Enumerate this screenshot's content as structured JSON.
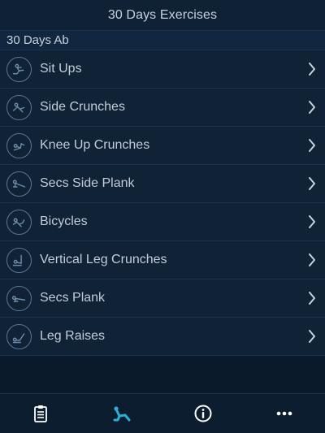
{
  "nav": {
    "title": "30 Days Exercises"
  },
  "section": {
    "title": "30 Days Ab"
  },
  "exercises": [
    {
      "label": "Sit Ups",
      "icon": "sit-ups-icon"
    },
    {
      "label": "Side Crunches",
      "icon": "side-crunches-icon"
    },
    {
      "label": "Knee Up Crunches",
      "icon": "knee-up-crunches-icon"
    },
    {
      "label": "Secs Side Plank",
      "icon": "side-plank-icon"
    },
    {
      "label": "Bicycles",
      "icon": "bicycles-icon"
    },
    {
      "label": "Vertical Leg Crunches",
      "icon": "vertical-leg-crunches-icon"
    },
    {
      "label": "Secs Plank",
      "icon": "plank-icon"
    },
    {
      "label": "Leg Raises",
      "icon": "leg-raises-icon"
    }
  ],
  "tabs": [
    {
      "name": "clipboard-icon",
      "active": false
    },
    {
      "name": "exercise-icon",
      "active": true
    },
    {
      "name": "info-icon",
      "active": false
    },
    {
      "name": "more-icon",
      "active": false
    }
  ],
  "colors": {
    "background": "#0b1a2b",
    "row": "#0f2236",
    "text": "#c3cdd7",
    "icon_stroke": "#5a7893",
    "tab_active": "#2ab0d6",
    "tab_inactive": "#ffffff"
  }
}
